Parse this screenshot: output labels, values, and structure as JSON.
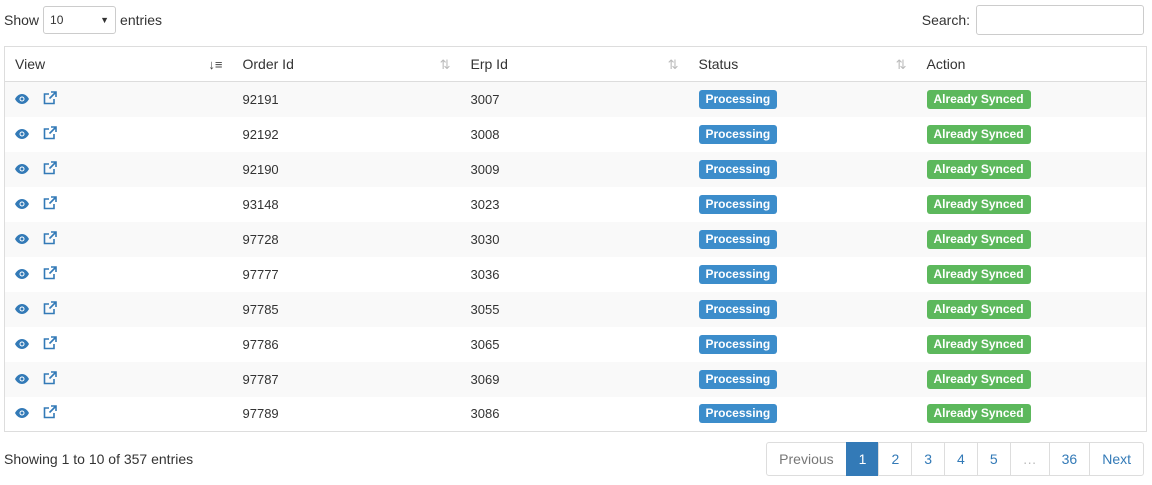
{
  "length": {
    "show_label": "Show",
    "selected": "10",
    "entries_label": "entries"
  },
  "search": {
    "label": "Search:",
    "value": ""
  },
  "table": {
    "headers": [
      "View",
      "Order Id",
      "Erp Id",
      "Status",
      "Action"
    ],
    "rows": [
      {
        "order_id": "92191",
        "erp_id": "3007",
        "status": "Processing",
        "action": "Already Synced"
      },
      {
        "order_id": "92192",
        "erp_id": "3008",
        "status": "Processing",
        "action": "Already Synced"
      },
      {
        "order_id": "92190",
        "erp_id": "3009",
        "status": "Processing",
        "action": "Already Synced"
      },
      {
        "order_id": "93148",
        "erp_id": "3023",
        "status": "Processing",
        "action": "Already Synced"
      },
      {
        "order_id": "97728",
        "erp_id": "3030",
        "status": "Processing",
        "action": "Already Synced"
      },
      {
        "order_id": "97777",
        "erp_id": "3036",
        "status": "Processing",
        "action": "Already Synced"
      },
      {
        "order_id": "97785",
        "erp_id": "3055",
        "status": "Processing",
        "action": "Already Synced"
      },
      {
        "order_id": "97786",
        "erp_id": "3065",
        "status": "Processing",
        "action": "Already Synced"
      },
      {
        "order_id": "97787",
        "erp_id": "3069",
        "status": "Processing",
        "action": "Already Synced"
      },
      {
        "order_id": "97789",
        "erp_id": "3086",
        "status": "Processing",
        "action": "Already Synced"
      }
    ]
  },
  "info": "Showing 1 to 10 of 357 entries",
  "pagination": {
    "previous": "Previous",
    "pages": [
      "1",
      "2",
      "3",
      "4",
      "5",
      "…",
      "36"
    ],
    "next": "Next",
    "active_page": "1"
  },
  "colors": {
    "link": "#337ab7",
    "processing": "#3c8dcb",
    "synced": "#5cb85c"
  },
  "icons": {
    "view": "eye-icon",
    "open": "external-link-icon"
  }
}
